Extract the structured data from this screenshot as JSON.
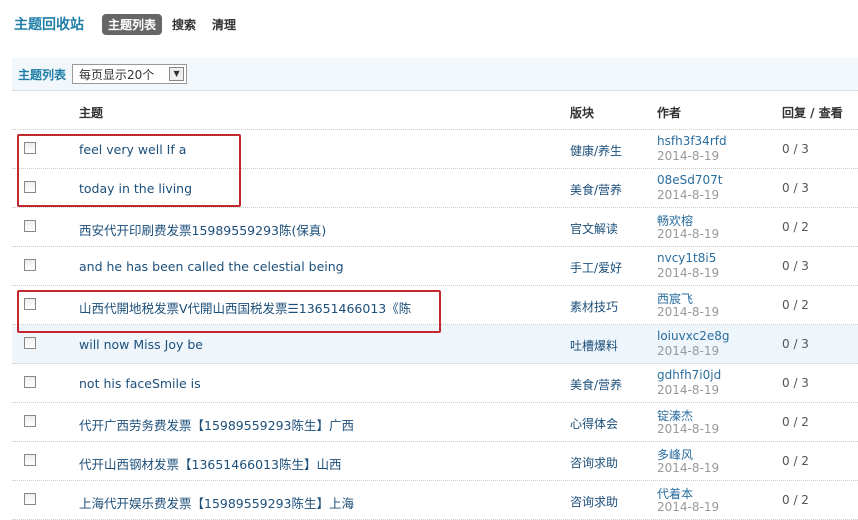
{
  "header": {
    "title": "主题回收站",
    "tabs": [
      {
        "label": "主题列表",
        "active": true
      },
      {
        "label": "搜索"
      },
      {
        "label": "清理"
      }
    ]
  },
  "toolbar": {
    "label": "主题列表",
    "per_page": "每页显示20个"
  },
  "columns": {
    "subject": "主题",
    "forum": "版块",
    "author": "作者",
    "replies_views": "回复 / 查看"
  },
  "rows": [
    {
      "subject": "feel very well If a",
      "forum": "健康/养生",
      "author": "hsfh3f34rfd",
      "date": "2014-8-19",
      "rv": "0 / 3"
    },
    {
      "subject": "today in the living",
      "forum": "美食/营养",
      "author": "08eSd707t",
      "date": "2014-8-19",
      "rv": "0 / 3"
    },
    {
      "subject": "西安代开印刷费发票15989559293陈(保真)",
      "forum": "官文解读",
      "author": "畅欢榕",
      "date": "2014-8-19",
      "rv": "0 / 2"
    },
    {
      "subject": "and he has been called the celestial being",
      "forum": "手工/爱好",
      "author": "nvcy1t8i5",
      "date": "2014-8-19",
      "rv": "0 / 3"
    },
    {
      "subject": "山西代開地税发票V代開山西国税发票☰13651466013《陈",
      "forum": "素材技巧",
      "author": "西宸飞",
      "date": "2014-8-19",
      "rv": "0 / 2"
    },
    {
      "subject": "will now Miss Joy be",
      "forum": "吐槽爆料",
      "author": "loiuvxc2e8g",
      "date": "2014-8-19",
      "rv": "0 / 3"
    },
    {
      "subject": "not his faceSmile is",
      "forum": "美食/营养",
      "author": "gdhfh7i0jd",
      "date": "2014-8-19",
      "rv": "0 / 3"
    },
    {
      "subject": "代开广西劳务费发票【15989559293陈生】广西",
      "forum": "心得体会",
      "author": "锭溱杰",
      "date": "2014-8-19",
      "rv": "0 / 2"
    },
    {
      "subject": "代开山西钢材发票【13651466013陈生】山西",
      "forum": "咨询求助",
      "author": "多峰风",
      "date": "2014-8-19",
      "rv": "0 / 2"
    },
    {
      "subject": "上海代开娱乐费发票【15989559293陈生】上海",
      "forum": "咨询求助",
      "author": "代着本",
      "date": "2014-8-19",
      "rv": "0 / 2"
    }
  ],
  "colors": {
    "accent": "#1f7ea8",
    "highlight_box": "#c1272d"
  }
}
